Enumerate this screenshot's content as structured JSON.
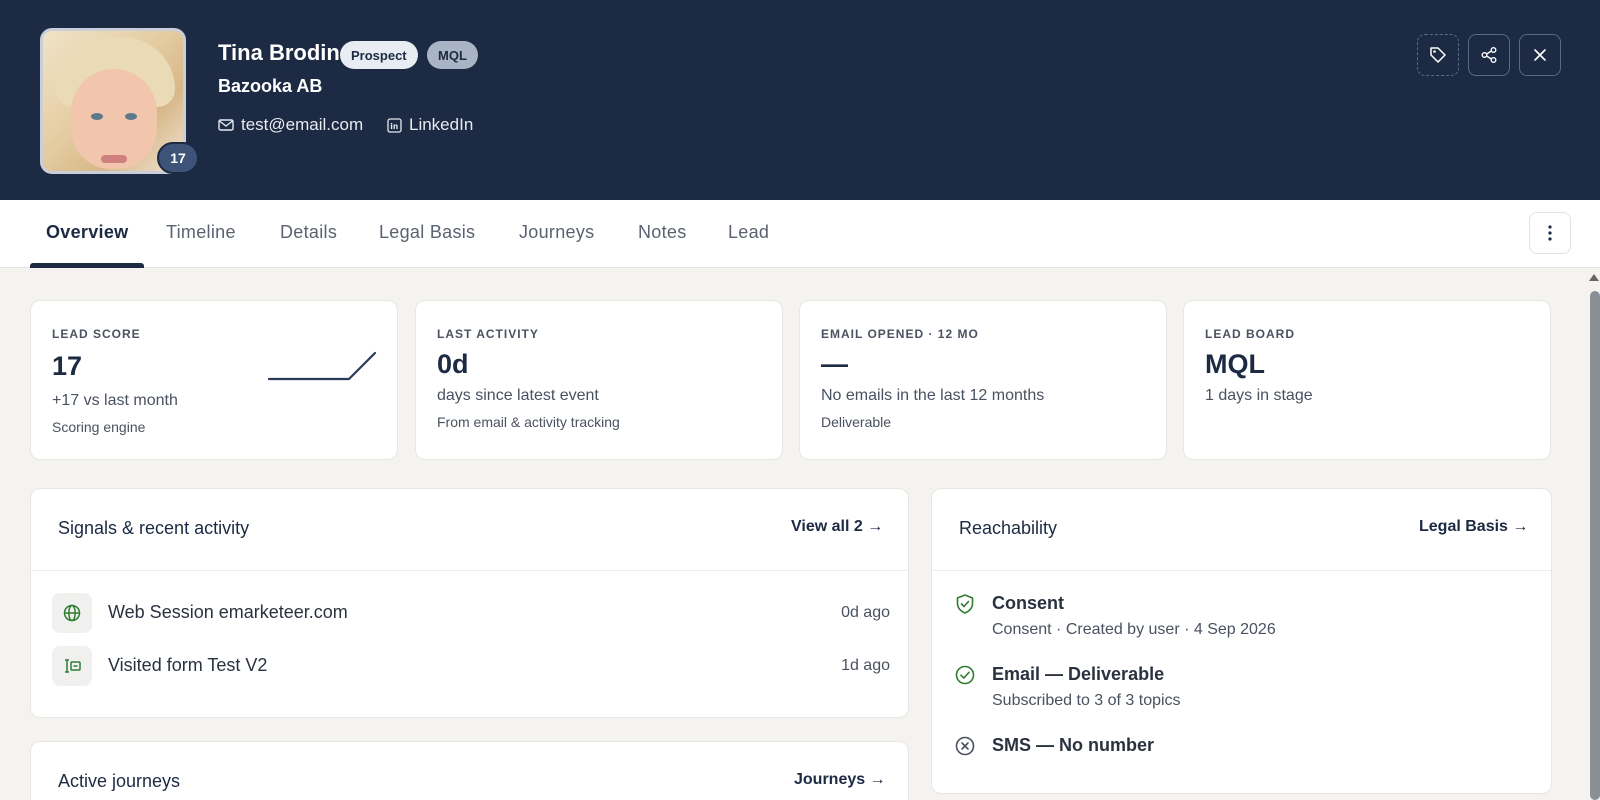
{
  "header": {
    "avatar_count": "17",
    "name": "Tina Brodin",
    "badges": [
      "Prospect",
      "MQL"
    ],
    "company": "Bazooka AB",
    "email": "test@email.com",
    "linkedin_label": "LinkedIn",
    "actions": [
      {
        "icon": "tag-icon"
      },
      {
        "icon": "share-icon"
      },
      {
        "icon": "close-icon"
      }
    ]
  },
  "tabs": [
    "Overview",
    "Timeline",
    "Details",
    "Legal Basis",
    "Journeys",
    "Notes",
    "Lead"
  ],
  "active_tab": "Overview",
  "kpis": [
    {
      "label": "LEAD SCORE",
      "value": "17",
      "sub": "+17 vs last month",
      "note": "Scoring engine"
    },
    {
      "label": "LAST ACTIVITY",
      "value": "0d",
      "sub": "days since latest event",
      "note": "From email & activity tracking"
    },
    {
      "label": "EMAIL OPENED · 12 MO",
      "value": "—",
      "sub": "No emails in the last 12 months",
      "note": "Deliverable"
    },
    {
      "label": "LEAD BOARD",
      "value": "MQL",
      "sub": "1 days in stage",
      "note": ""
    }
  ],
  "signals": {
    "title": "Signals & recent activity",
    "link": "View all 2 →",
    "items": [
      {
        "text": "Web Session emarketeer.com",
        "time": "0d ago",
        "icon": "globe-icon"
      },
      {
        "text": "Visited form Test V2",
        "time": "1d ago",
        "icon": "form-icon"
      }
    ]
  },
  "reachability": {
    "title": "Reachability",
    "link": "Legal Basis →",
    "items": [
      {
        "title": "Consent",
        "sub": "Consent · Created by user · 4 Sep 2026",
        "icon": "shield-icon",
        "color": "#2e7d32"
      },
      {
        "title": "Email — Deliverable",
        "sub": "Subscribed to 3 of 3 topics",
        "icon": "check-circle-icon",
        "color": "#2e7d32"
      },
      {
        "title": "SMS — No number",
        "sub": "",
        "icon": "x-circle-icon",
        "color": "#4a5160"
      }
    ]
  },
  "journeys": {
    "title": "Active journeys",
    "link": "Journeys →"
  }
}
